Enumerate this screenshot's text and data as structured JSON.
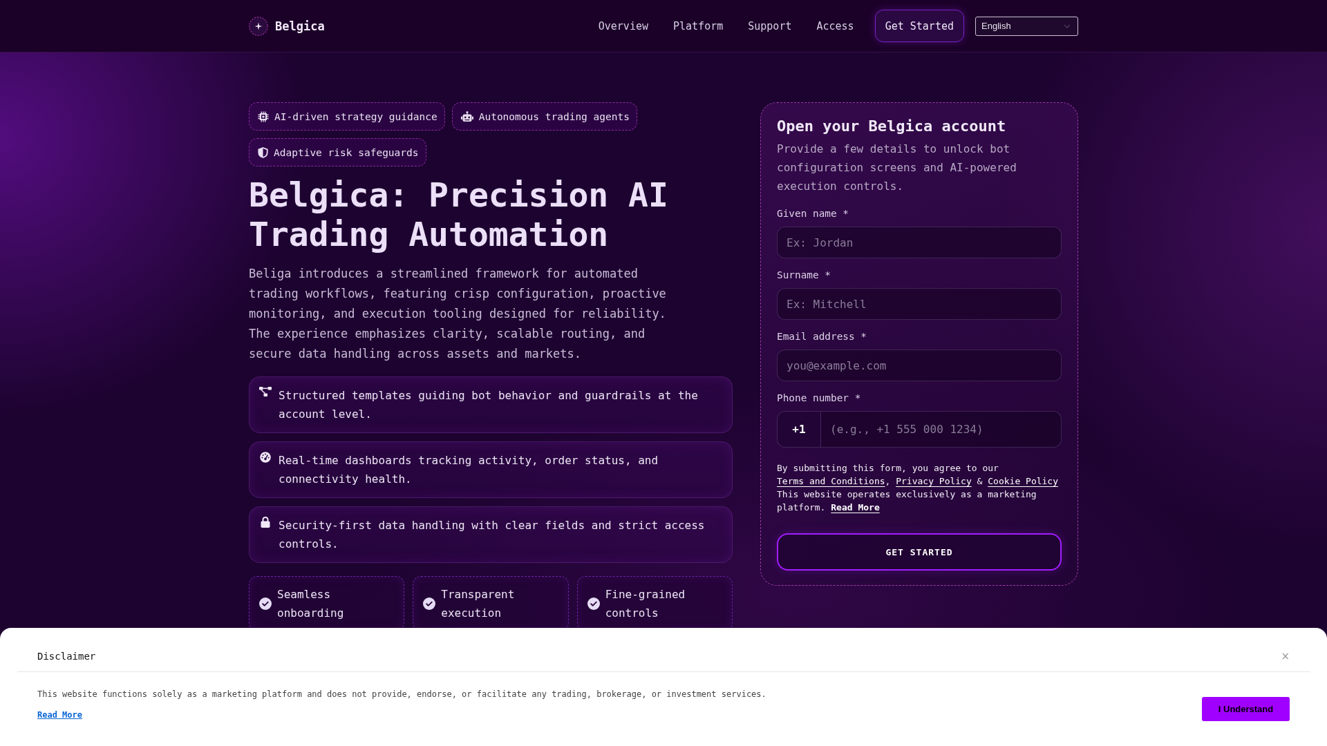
{
  "header": {
    "brand": "Belgica",
    "nav": [
      {
        "label": "Overview"
      },
      {
        "label": "Platform"
      },
      {
        "label": "Support"
      },
      {
        "label": "Access"
      }
    ],
    "cta": "Get Started",
    "language": "English"
  },
  "hero": {
    "tags": [
      {
        "label": "AI-driven strategy guidance"
      },
      {
        "label": "Autonomous trading agents"
      },
      {
        "label": "Adaptive risk safeguards"
      }
    ],
    "title": "Belgica: Precision AI Trading Automation",
    "description": "Beliga introduces a streamlined framework for automated trading workflows, featuring crisp configuration, proactive monitoring, and execution tooling designed for reliability. The experience emphasizes clarity, scalable routing, and secure data handling across assets and markets.",
    "features": [
      {
        "text": "Structured templates guiding bot behavior and guardrails at the account level."
      },
      {
        "text": "Real-time dashboards tracking activity, order status, and connectivity health."
      },
      {
        "text": "Security-first data handling with clear fields and strict access controls."
      }
    ],
    "highlights": [
      {
        "label": "Seamless onboarding"
      },
      {
        "label": "Transparent execution"
      },
      {
        "label": "Fine-grained controls"
      }
    ]
  },
  "signup": {
    "title": "Open your Belgica account",
    "description": "Provide a few details to unlock bot configuration screens and AI-powered execution controls.",
    "fields": [
      {
        "kind": "text",
        "label": "Given name *",
        "placeholder": "Ex: Jordan"
      },
      {
        "kind": "text",
        "label": "Surname *",
        "placeholder": "Ex: Mitchell"
      },
      {
        "kind": "email",
        "label": "Email address *",
        "placeholder": "you@example.com"
      },
      {
        "kind": "phone",
        "label": "Phone number *",
        "prefix": "+1",
        "placeholder": "(e.g., +1 555 000 1234)"
      }
    ],
    "consent": [
      {
        "kind": "text",
        "text": "By submitting this form, you agree to our "
      },
      {
        "kind": "link",
        "text": "Terms and Conditions"
      },
      {
        "kind": "text",
        "text": ", "
      },
      {
        "kind": "link",
        "text": "Privacy Policy"
      },
      {
        "kind": "text",
        "text": " & "
      },
      {
        "kind": "link",
        "text": "Cookie Policy"
      }
    ],
    "notice": [
      {
        "kind": "text",
        "text": "This website operates exclusively as a marketing platform. "
      },
      {
        "kind": "bold_link",
        "text": "Read More"
      }
    ],
    "submit": "GET STARTED"
  },
  "disclaimer": {
    "title": "Disclaimer",
    "close": "×",
    "text": "This website functions solely as a marketing platform and does not provide, endorse, or facilitate any trading, brokerage, or investment services.",
    "link": "Read More",
    "button": "I Understand"
  }
}
